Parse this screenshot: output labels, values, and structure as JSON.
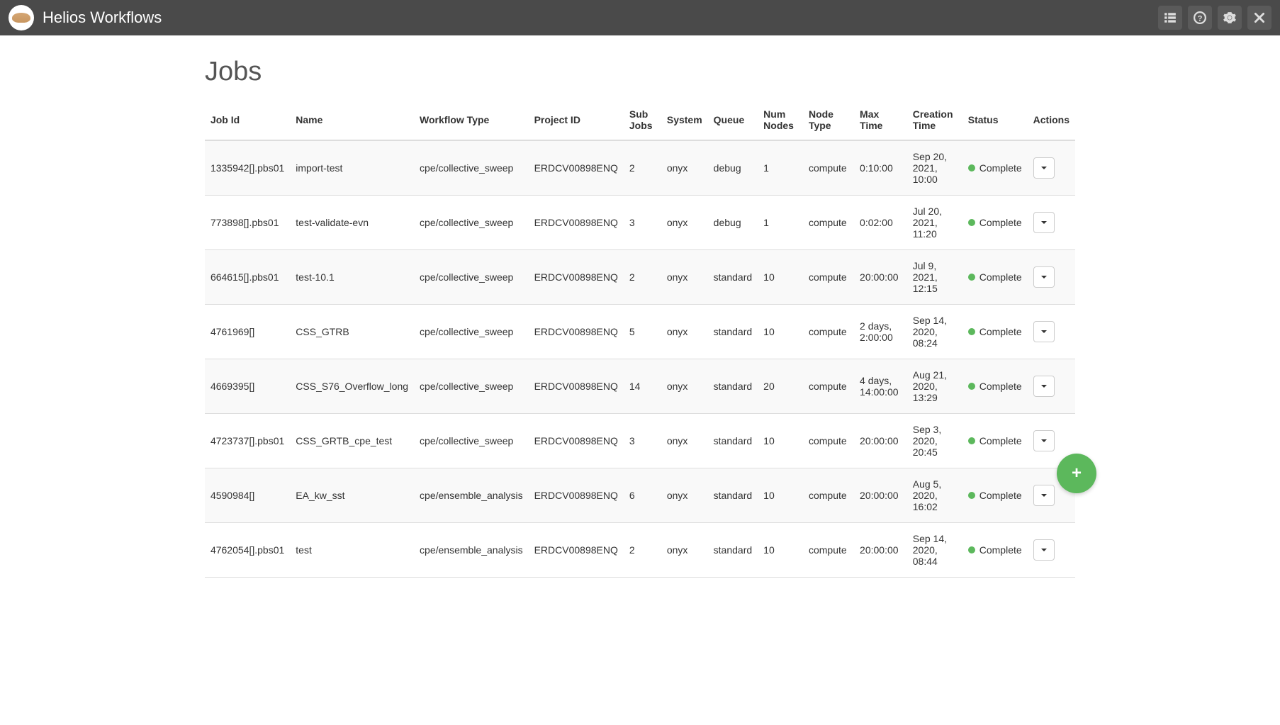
{
  "app": {
    "title": "Helios Workflows"
  },
  "page": {
    "title": "Jobs"
  },
  "table": {
    "headers": {
      "job_id": "Job Id",
      "name": "Name",
      "workflow_type": "Workflow Type",
      "project_id": "Project ID",
      "sub_jobs": "Sub Jobs",
      "system": "System",
      "queue": "Queue",
      "num_nodes": "Num Nodes",
      "node_type": "Node Type",
      "max_time": "Max Time",
      "creation_time": "Creation Time",
      "status": "Status",
      "actions": "Actions"
    },
    "rows": [
      {
        "job_id": "1335942[].pbs01",
        "name": "import-test",
        "workflow_type": "cpe/collective_sweep",
        "project_id": "ERDCV00898ENQ",
        "sub_jobs": "2",
        "system": "onyx",
        "queue": "debug",
        "num_nodes": "1",
        "node_type": "compute",
        "max_time": "0:10:00",
        "creation_time": "Sep 20, 2021, 10:00",
        "status": "Complete"
      },
      {
        "job_id": "773898[].pbs01",
        "name": "test-validate-evn",
        "workflow_type": "cpe/collective_sweep",
        "project_id": "ERDCV00898ENQ",
        "sub_jobs": "3",
        "system": "onyx",
        "queue": "debug",
        "num_nodes": "1",
        "node_type": "compute",
        "max_time": "0:02:00",
        "creation_time": "Jul 20, 2021, 11:20",
        "status": "Complete"
      },
      {
        "job_id": "664615[].pbs01",
        "name": "test-10.1",
        "workflow_type": "cpe/collective_sweep",
        "project_id": "ERDCV00898ENQ",
        "sub_jobs": "2",
        "system": "onyx",
        "queue": "standard",
        "num_nodes": "10",
        "node_type": "compute",
        "max_time": "20:00:00",
        "creation_time": "Jul 9, 2021, 12:15",
        "status": "Complete"
      },
      {
        "job_id": "4761969[]",
        "name": "CSS_GTRB",
        "workflow_type": "cpe/collective_sweep",
        "project_id": "ERDCV00898ENQ",
        "sub_jobs": "5",
        "system": "onyx",
        "queue": "standard",
        "num_nodes": "10",
        "node_type": "compute",
        "max_time": "2 days, 2:00:00",
        "creation_time": "Sep 14, 2020, 08:24",
        "status": "Complete"
      },
      {
        "job_id": "4669395[]",
        "name": "CSS_S76_Overflow_long",
        "workflow_type": "cpe/collective_sweep",
        "project_id": "ERDCV00898ENQ",
        "sub_jobs": "14",
        "system": "onyx",
        "queue": "standard",
        "num_nodes": "20",
        "node_type": "compute",
        "max_time": "4 days, 14:00:00",
        "creation_time": "Aug 21, 2020, 13:29",
        "status": "Complete"
      },
      {
        "job_id": "4723737[].pbs01",
        "name": "CSS_GRTB_cpe_test",
        "workflow_type": "cpe/collective_sweep",
        "project_id": "ERDCV00898ENQ",
        "sub_jobs": "3",
        "system": "onyx",
        "queue": "standard",
        "num_nodes": "10",
        "node_type": "compute",
        "max_time": "20:00:00",
        "creation_time": "Sep 3, 2020, 20:45",
        "status": "Complete"
      },
      {
        "job_id": "4590984[]",
        "name": "EA_kw_sst",
        "workflow_type": "cpe/ensemble_analysis",
        "project_id": "ERDCV00898ENQ",
        "sub_jobs": "6",
        "system": "onyx",
        "queue": "standard",
        "num_nodes": "10",
        "node_type": "compute",
        "max_time": "20:00:00",
        "creation_time": "Aug 5, 2020, 16:02",
        "status": "Complete"
      },
      {
        "job_id": "4762054[].pbs01",
        "name": "test",
        "workflow_type": "cpe/ensemble_analysis",
        "project_id": "ERDCV00898ENQ",
        "sub_jobs": "2",
        "system": "onyx",
        "queue": "standard",
        "num_nodes": "10",
        "node_type": "compute",
        "max_time": "20:00:00",
        "creation_time": "Sep 14, 2020, 08:44",
        "status": "Complete"
      }
    ]
  },
  "colors": {
    "status_complete": "#5cb85c",
    "fab": "#5cb85c",
    "navbar": "#4a4a4a"
  }
}
